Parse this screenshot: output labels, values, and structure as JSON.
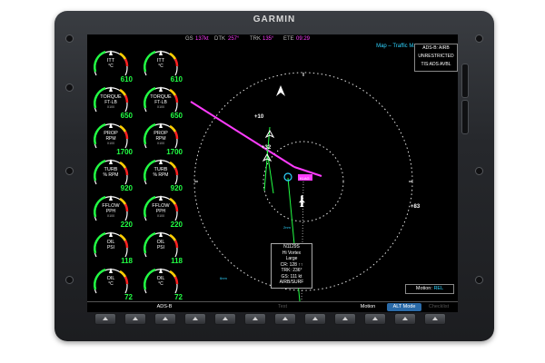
{
  "device": {
    "brand": "GARMIN"
  },
  "topbar": {
    "gs_label": "GS",
    "gs_value": "137kt",
    "dtk_label": "DTK",
    "dtk_value": "257°",
    "trk_label": "TRK",
    "trk_value": "135°",
    "ete_label": "ETE",
    "ete_value": "09:29"
  },
  "map": {
    "title": "Map – Traffic Map",
    "adsb_status": [
      "ADS-B: AIRB",
      "UNRESTRICTED",
      "TIS:ADS AVBL"
    ],
    "targets": [
      {
        "label": "+10"
      },
      {
        "label": "+32"
      },
      {
        "label": "+83"
      }
    ],
    "waypoint_tag": "KLAG",
    "range_labels": [
      "2nm",
      "6nm"
    ],
    "infobox": [
      "N1129S",
      "Hi Vortex",
      "Large",
      "",
      "CR: 128 ↑↑",
      "TRK: 236°",
      "GS: 111 kt",
      "AIRB/SURF"
    ],
    "motion_label": "Motion:",
    "motion_value": "REL"
  },
  "gauges": [
    {
      "name": "ITT",
      "unit": "°C",
      "scale": "",
      "value": "610"
    },
    {
      "name": "ITT",
      "unit": "°C",
      "scale": "",
      "value": "610"
    },
    {
      "name": "TORQUE",
      "unit": "FT-LB",
      "scale": "X100",
      "value": "650"
    },
    {
      "name": "TORQUE",
      "unit": "FT-LB",
      "scale": "X100",
      "value": "650"
    },
    {
      "name": "PROP",
      "unit": "RPM",
      "scale": "X100",
      "value": "1700"
    },
    {
      "name": "PROP",
      "unit": "RPM",
      "scale": "X100",
      "value": "1700"
    },
    {
      "name": "TURB",
      "unit": "% RPM",
      "scale": "",
      "value": "920"
    },
    {
      "name": "TURB",
      "unit": "% RPM",
      "scale": "",
      "value": "920"
    },
    {
      "name": "FFLOW",
      "unit": "PPH",
      "scale": "X100",
      "value": "220"
    },
    {
      "name": "FFLOW",
      "unit": "PPH",
      "scale": "X100",
      "value": "220"
    },
    {
      "name": "OIL",
      "unit": "PSI",
      "scale": "",
      "value": "118"
    },
    {
      "name": "OIL",
      "unit": "PSI",
      "scale": "",
      "value": "118"
    },
    {
      "name": "OIL",
      "unit": "°C",
      "scale": "",
      "value": "72"
    },
    {
      "name": "OIL",
      "unit": "°C",
      "scale": "",
      "value": "72"
    }
  ],
  "softkeys": {
    "adsb": "ADS-B",
    "test": "Test",
    "motion": "Motion",
    "alt_mode": "ALT Mode",
    "checklist": "Checklist"
  },
  "colors": {
    "magenta": "#ff3cff",
    "cyan": "#2fd4ff",
    "green": "#22ff44"
  }
}
